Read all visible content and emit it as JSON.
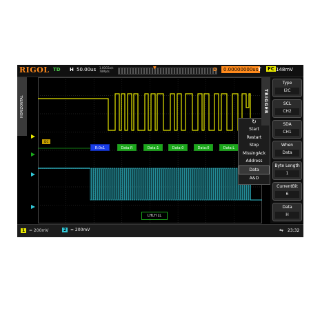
{
  "topbar": {
    "logo": "RIGOL",
    "run_state": "TD",
    "h_label": "H",
    "h_value": "50.00us",
    "sample_rate_line1": "1.00GSa/s",
    "sample_rate_line2": "78Mpts",
    "d_label": "D",
    "d_value": "0.00000000us",
    "t_label": "T",
    "t_source": "FC",
    "t_level": "148mV"
  },
  "side_tag": "HORIZONTAL",
  "trigger_tab": "TRIGGER",
  "i2c_tag": "I2C",
  "decode_packets": [
    "R:0x1",
    "Data:R",
    "Data:1",
    "Data:0",
    "Data:0",
    "Data:L"
  ],
  "menu_popup": {
    "items": [
      "Start",
      "Restart",
      "Stop",
      "MissingAck",
      "Address",
      "Data",
      "A&D"
    ],
    "selected": "Data"
  },
  "softkeys": [
    {
      "key": "Type",
      "value": "I2C"
    },
    {
      "key": "SCL",
      "value": "CH2"
    },
    {
      "key": "SDA",
      "value": "CH1"
    },
    {
      "key": "When",
      "value": "Data"
    },
    {
      "key": "Byte Length",
      "value": "1"
    },
    {
      "key": "CurrentBit",
      "value": "6"
    },
    {
      "key": "Data",
      "value": "H"
    }
  ],
  "bottom_box": "LHLH LL",
  "bottombar": {
    "ch1_label": "1",
    "ch1_scale": "= 200mV",
    "ch2_label": "2",
    "ch2_scale": "= 200mV",
    "usb_icon": "usb-icon",
    "time": "23:32"
  },
  "colors": {
    "ch1": "#e8e800",
    "ch2": "#32c8d8",
    "accent": "#ff8a1c",
    "decode_data": "#1aa81a",
    "decode_addr": "#1a3ee8"
  }
}
